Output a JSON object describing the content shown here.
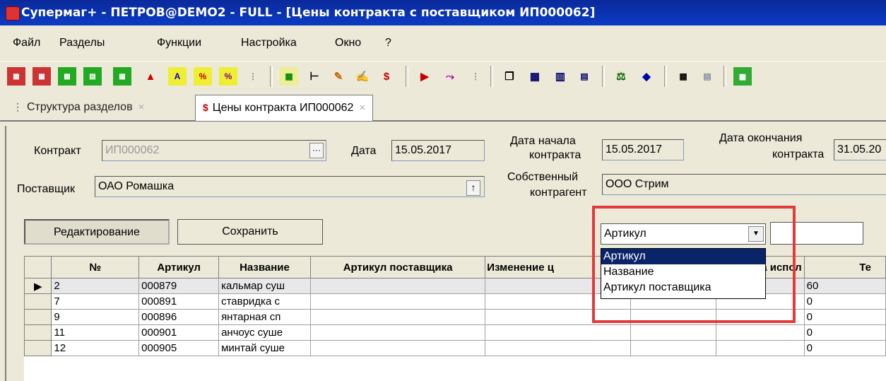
{
  "window": {
    "title": "Супермаг+ - ПЕТРОВ@DEMO2 - FULL  - [Цены контракта с поставщиком ИП000062]"
  },
  "menu": [
    {
      "label": "Файл"
    },
    {
      "label": "Разделы"
    },
    {
      "label": "Функции"
    },
    {
      "label": "Настройка"
    },
    {
      "label": "Окно"
    },
    {
      "label": "?"
    }
  ],
  "toolbar": {
    "price_icon_glyph": "$"
  },
  "tabs": [
    {
      "label": "Структура разделов",
      "icon": "tree-icon",
      "active": false
    },
    {
      "label": "Цены контракта ИП000062",
      "icon": "price-table-icon",
      "icon_glyph": "$",
      "active": true
    }
  ],
  "tab_close_glyph": "×",
  "form": {
    "contract_label": "Контракт",
    "contract_value": "ИП000062",
    "date_label": "Дата",
    "date_value": "15.05.2017",
    "start_label_1": "Дата начала",
    "start_label_2": "контракта",
    "start_value": "15.05.2017",
    "end_label_1": "Дата окончания",
    "end_label_2": "контракта",
    "end_value": "31.05.20",
    "supplier_label": "Поставщик",
    "supplier_value": "ОАО Ромашка",
    "own_label_1": "Собственный",
    "own_label_2": "контрагент",
    "own_value": "ООО Стрим"
  },
  "buttons": {
    "edit": "Редактирование",
    "save": "Сохранить"
  },
  "search": {
    "field_selected": "Артикул",
    "options": [
      "Артикул",
      "Название",
      "Артикул поставщика"
    ],
    "value": ""
  },
  "grid": {
    "columns": [
      "№",
      "Артикул",
      "Название",
      "Артикул поставщика",
      "Изменение ц",
      "",
      "ата испол",
      "Те"
    ],
    "rows": [
      {
        "no": "2",
        "article": "000879",
        "name": "кальмар суш",
        "supplier_article": "",
        "change": "",
        "c6": "",
        "c7": "",
        "c8": "60"
      },
      {
        "no": "7",
        "article": "000891",
        "name": "ставридка с",
        "supplier_article": "",
        "change": "",
        "c6": "",
        "c7": "",
        "c8": "0"
      },
      {
        "no": "9",
        "article": "000896",
        "name": "янтарная сп",
        "supplier_article": "",
        "change": "",
        "c6": "",
        "c7": "",
        "c8": "0"
      },
      {
        "no": "11",
        "article": "000901",
        "name": "анчоус суше",
        "supplier_article": "",
        "change": "",
        "c6": "",
        "c7": "",
        "c8": "0"
      },
      {
        "no": "12",
        "article": "000905",
        "name": "минтай суше",
        "supplier_article": "",
        "change": "",
        "c6": "",
        "c7": "",
        "c8": "0"
      }
    ]
  },
  "colors": {
    "highlight_box": "#e23b3b",
    "titlebar": "#0b3bc4",
    "selection": "#0a246a"
  }
}
